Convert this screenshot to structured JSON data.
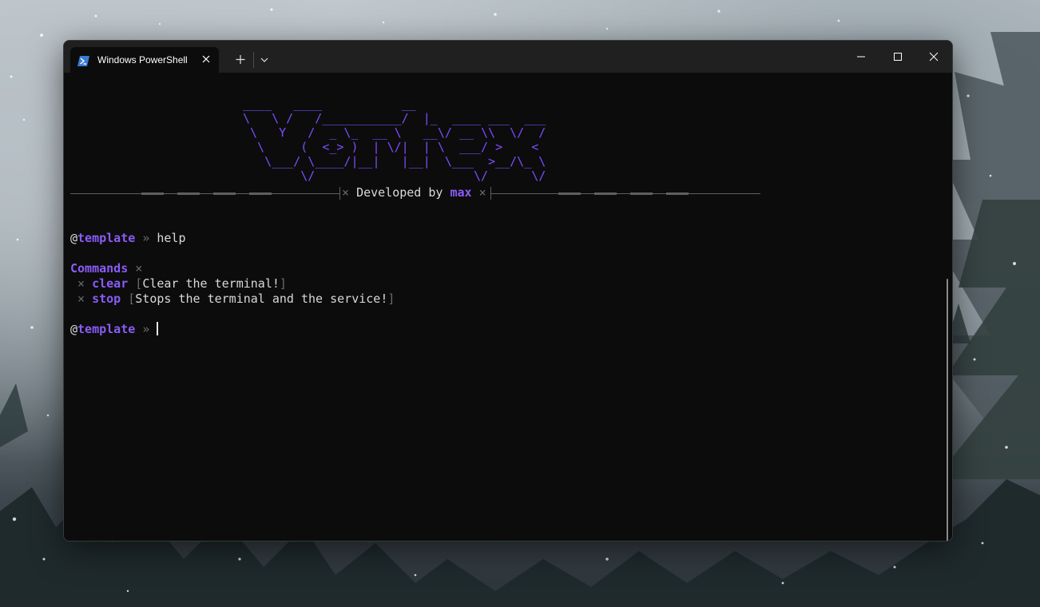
{
  "window": {
    "tab_title": "Windows PowerShell",
    "tab_icon": "powershell-icon",
    "new_tab_icon": "plus-icon",
    "dropdown_icon": "chevron-down-icon",
    "controls": [
      "minimize-icon",
      "maximize-icon",
      "close-icon"
    ]
  },
  "terminal": {
    "banner": "____   ____           __\n\\   \\ /   /___________/  |_  ____ ___  ___\n \\   Y   /  _ \\_  __ \\   __\\/ __ \\\\  \\/  /\n  \\     (  <_> )  | \\/|  | \\  ___/ >    <\n   \\___/ \\____/|__|   |__|  \\___  >__/\\_ \\\n        \\/                      \\/      \\/",
    "developed_mark": "×",
    "developed_prefix": "Developed by",
    "developer": "max",
    "prompt_at": "@",
    "prompt_user": "template",
    "prompt_arrow": "»",
    "entered_command": "help",
    "commands_heading": "Commands",
    "heading_mark": "×",
    "bullet": "×",
    "bracket_open": "[",
    "bracket_close": "]",
    "commands": [
      {
        "name": "clear",
        "description": "Clear the terminal!"
      },
      {
        "name": "stop",
        "description": "Stops the terminal and the service!"
      }
    ]
  },
  "colors": {
    "accent": "#8a5cf6",
    "banner": "#7c4dff",
    "background": "#0c0c0c",
    "titlebar": "#202020"
  }
}
